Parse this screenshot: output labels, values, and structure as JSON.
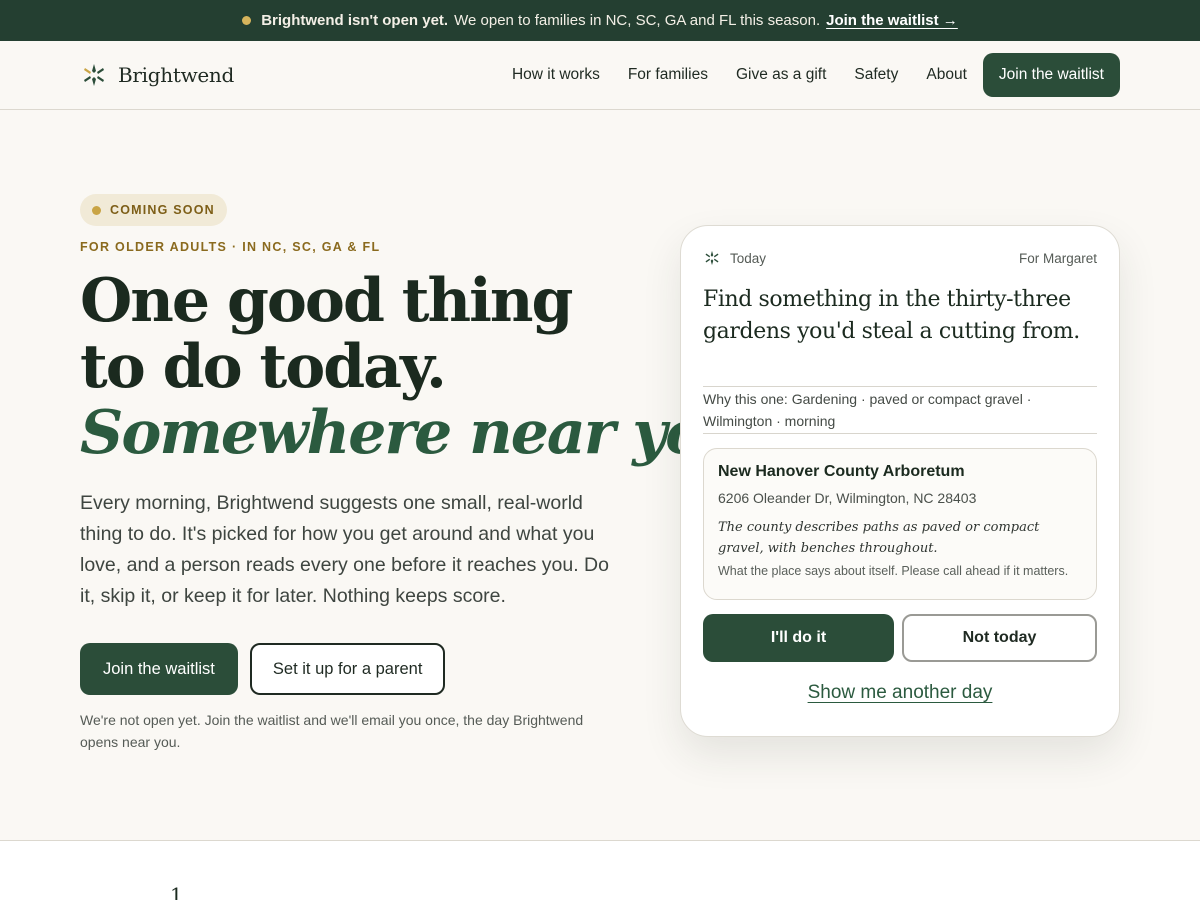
{
  "announcement": {
    "bold": "Brightwend isn't open yet.",
    "text": "We open to families in NC, SC, GA and FL this season.",
    "link": "Join the waitlist →",
    "dot_color": "#d6b45c"
  },
  "header": {
    "brand": "Brightwend",
    "logo_icon": "sparkle-logo-icon",
    "nav": [
      "How it works",
      "For families",
      "Give as a gift",
      "Safety",
      "About"
    ],
    "cta": "Join the waitlist"
  },
  "hero": {
    "badge": "COMING SOON",
    "eyebrow": "FOR OLDER ADULTS · IN NC, SC, GA & FL",
    "headline_line1": "One good thing",
    "headline_line2": "to do today.",
    "headline_line3": "Somewhere near you.",
    "lede": "Every morning, Brightwend suggests one small, real-world thing to do. It's picked for how you get around and what you love, and a person reads every one before it reaches you. Do it, skip it, or keep it for later. Nothing keeps score.",
    "cta_primary": "Join the waitlist",
    "cta_secondary": "Set it up for a parent",
    "note": "We're not open yet. Join the waitlist and we'll email you once, the day Brightwend opens near you."
  },
  "card": {
    "label": "Today",
    "for": "For Margaret",
    "title": "Find something in the thirty-three gardens you'd steal a cutting from.",
    "why": "Why this one: Gardening · paved or compact gravel · Wilmington · morning",
    "place": {
      "name": "New Hanover County Arboretum",
      "address": "6206 Oleander Dr, Wilmington, NC 28403",
      "description": "The county describes paths as paved or compact gravel, with benches throughout.",
      "disclaimer": "What the place says about itself. Please call ahead if it matters."
    },
    "do_button": "I'll do it",
    "skip_button": "Not today",
    "another_link": "Show me another day"
  },
  "lower": {
    "step_number": "1"
  },
  "colors": {
    "brand_green": "#2b4d39",
    "banner_green": "#243f31",
    "accent_gold": "#c9a445",
    "background": "#faf8f4"
  }
}
